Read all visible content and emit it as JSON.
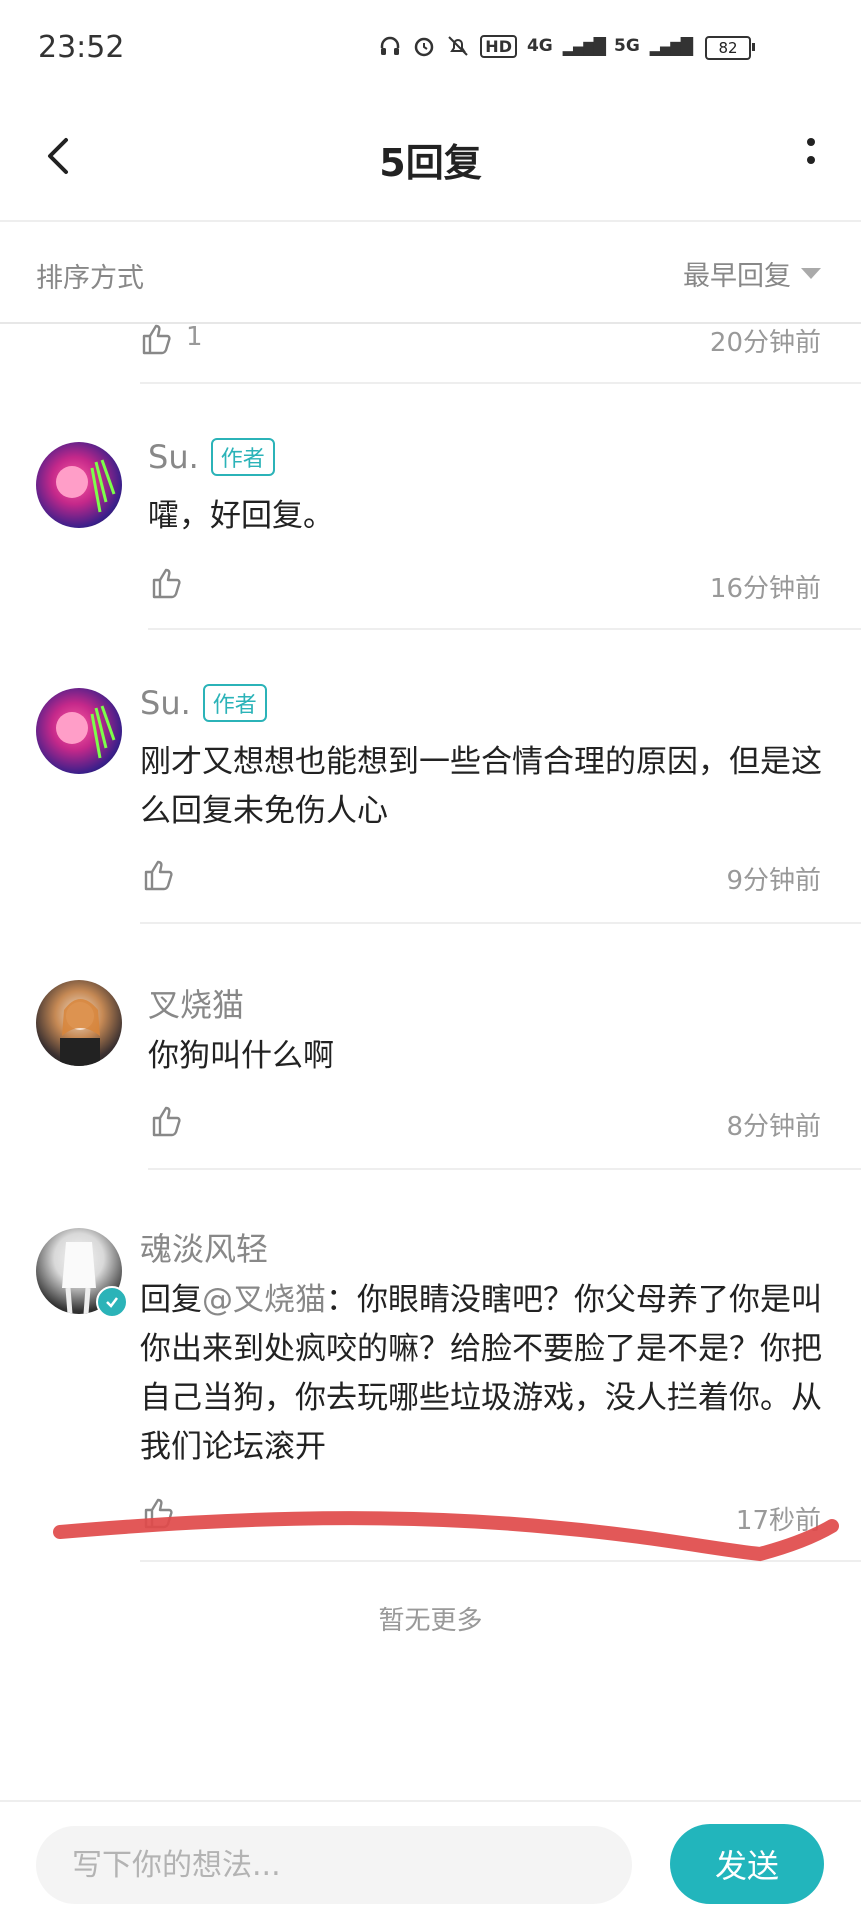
{
  "status_bar": {
    "time": "23:52",
    "battery": "82",
    "network_a": "4G",
    "network_b": "5G",
    "hd": "HD"
  },
  "header": {
    "title": "5回复"
  },
  "sort": {
    "label": "排序方式",
    "value": "最早回复"
  },
  "partial_comment": {
    "like_count": "1",
    "time": "20分钟前"
  },
  "comments": [
    {
      "username": "Su.",
      "badge": "作者",
      "content": "嚯，好回复。",
      "time": "16分钟前"
    },
    {
      "username": "Su.",
      "badge": "作者",
      "content": "刚才又想想也能想到一些合情合理的原因，但是这么回复未免伤人心",
      "time": "9分钟前"
    },
    {
      "username": "叉烧猫",
      "content": "你狗叫什么啊",
      "time": "8分钟前"
    },
    {
      "username": "魂淡风轻",
      "reply_prefix": "回复",
      "mention": "@叉烧猫",
      "content": "：你眼睛没瞎吧？你父母养了你是叫你出来到处疯咬的嘛？给脸不要脸了是不是？你把自己当狗，你去玩哪些垃圾游戏，没人拦着你。从我们论坛滚开",
      "time": "17秒前"
    }
  ],
  "footer": {
    "no_more": "暂无更多"
  },
  "bottom_bar": {
    "placeholder": "写下你的想法...",
    "send_label": "发送"
  },
  "colors": {
    "accent": "#22b5bc",
    "badge": "#2bb3b8",
    "annotation": "#e04a4a"
  },
  "icons": [
    "back-icon",
    "more-icon",
    "caret-down-icon",
    "like-icon",
    "verified-icon",
    "headphones-icon",
    "alarm-icon",
    "mute-icon"
  ]
}
